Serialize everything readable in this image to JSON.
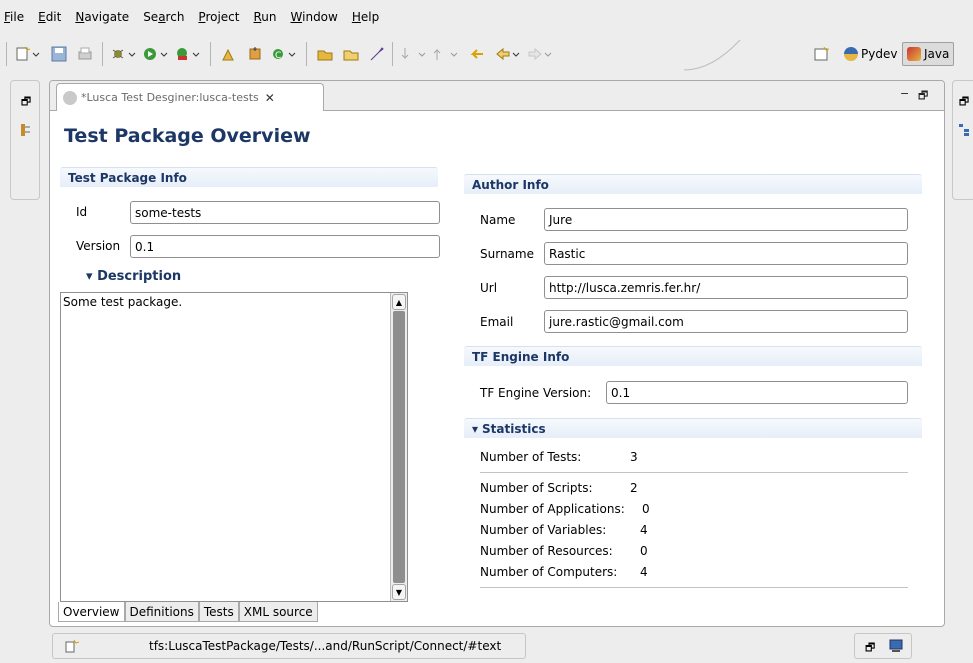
{
  "menu": [
    {
      "mnemonic": "F",
      "rest": "ile"
    },
    {
      "mnemonic": "E",
      "rest": "dit"
    },
    {
      "mnemonic": "N",
      "rest": "avigate"
    },
    {
      "pre": "Se",
      "mnemonic": "a",
      "rest": "rch"
    },
    {
      "mnemonic": "P",
      "rest": "roject"
    },
    {
      "mnemonic": "R",
      "rest": "un"
    },
    {
      "mnemonic": "W",
      "rest": "indow"
    },
    {
      "mnemonic": "H",
      "rest": "elp"
    }
  ],
  "perspectives": {
    "pydev": "Pydev",
    "java": "Java"
  },
  "editor": {
    "tab_title": "*Lusca Test Desginer:lusca-tests",
    "page_title": "Test Package Overview",
    "package_info": {
      "header": "Test Package Info",
      "id_label": "Id",
      "id_value": "some-tests",
      "version_label": "Version",
      "version_value": "0.1",
      "description_label": "Description",
      "description_value": "Some test package."
    },
    "author_info": {
      "header": "Author Info",
      "name_label": "Name",
      "name_value": "Jure",
      "surname_label": "Surname",
      "surname_value": "Rastic",
      "url_label": "Url",
      "url_value": "http://lusca.zemris.fer.hr/",
      "email_label": "Email",
      "email_value": "jure.rastic@gmail.com"
    },
    "engine_info": {
      "header": "TF Engine Info",
      "version_label": "TF Engine Version:",
      "version_value": "0.1"
    },
    "statistics": {
      "header": "Statistics",
      "rows": [
        {
          "label": "Number of Tests:",
          "value": "3"
        },
        {
          "label": "Number of Scripts:",
          "value": "2"
        },
        {
          "label": "Number of Applications:",
          "value": "0"
        },
        {
          "label": "Number of Variables:",
          "value": "4"
        },
        {
          "label": "Number of Resources:",
          "value": "0"
        },
        {
          "label": "Number of Computers:",
          "value": "4"
        }
      ]
    },
    "bottom_tabs": [
      "Overview",
      "Definitions",
      "Tests",
      "XML source"
    ]
  },
  "status": {
    "path": "tfs:LuscaTestPackage/Tests/...and/RunScript/Connect/#text"
  }
}
